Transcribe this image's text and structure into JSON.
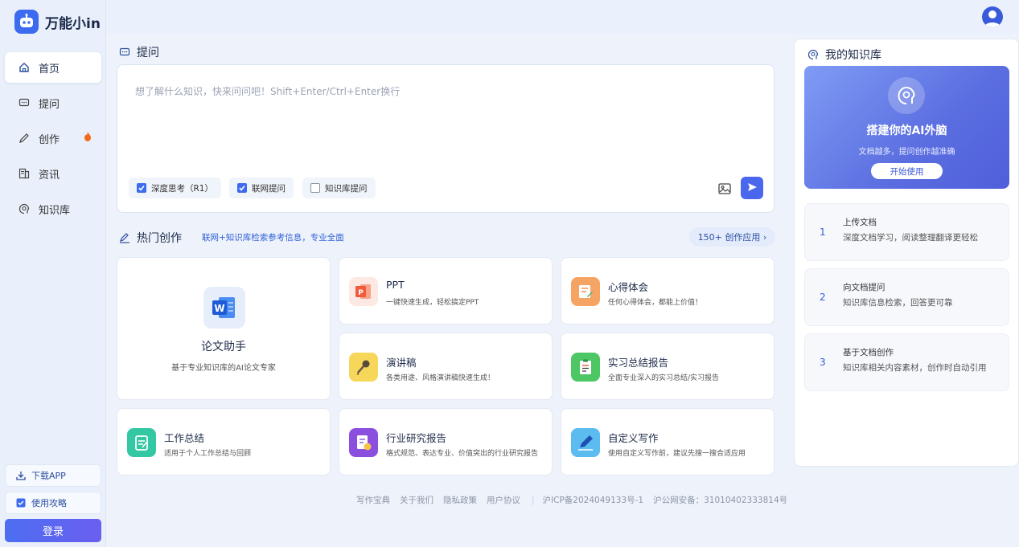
{
  "app": {
    "name": "万能小in"
  },
  "sidebar": {
    "items": [
      {
        "label": "首页",
        "icon": "home-icon",
        "active": true
      },
      {
        "label": "提问",
        "icon": "chat-icon"
      },
      {
        "label": "创作",
        "icon": "pencil-icon",
        "badge": "flame-icon"
      },
      {
        "label": "资讯",
        "icon": "news-icon"
      },
      {
        "label": "知识库",
        "icon": "brain-icon"
      }
    ],
    "download_label": "下载APP",
    "guide_label": "使用攻略",
    "login_label": "登录"
  },
  "ask": {
    "title": "提问",
    "placeholder": "想了解什么知识，快来问问吧！Shift+Enter/Ctrl+Enter换行",
    "options": [
      {
        "label": "深度思考（R1）",
        "checked": true
      },
      {
        "label": "联网提问",
        "checked": true
      },
      {
        "label": "知识库提问",
        "checked": false
      }
    ]
  },
  "hot": {
    "title": "热门创作",
    "subtitle": "联网+知识库检索参考信息，专业全面",
    "more_label": "150+ 创作应用 ›",
    "featured": {
      "title": "论文助手",
      "desc": "基于专业知识库的AI论文专家",
      "icon": "word-icon"
    },
    "cards": [
      {
        "title": "PPT",
        "desc": "一键快速生成，轻松搞定PPT",
        "icon": "ppt-icon",
        "color": "#f15a3a"
      },
      {
        "title": "心得体会",
        "desc": "任何心得体会，都能上价值！",
        "icon": "notes-icon",
        "color": "#f08c4a"
      },
      {
        "title": "演讲稿",
        "desc": "各类用途、风格演讲稿快速生成！",
        "icon": "microphone-icon",
        "color": "#f3c43a"
      },
      {
        "title": "实习总结报告",
        "desc": "全面专业深入的实习总结/实习报告",
        "icon": "clipboard-icon",
        "color": "#3cbf5a"
      },
      {
        "title": "工作总结",
        "desc": "适用于个人工作总结与回顾",
        "icon": "checklist-icon",
        "color": "#2bc6a0"
      },
      {
        "title": "行业研究报告",
        "desc": "格式规范、表达专业、价值突出的行业研究报告",
        "icon": "report-icon",
        "color": "#8b4fe0"
      },
      {
        "title": "自定义写作",
        "desc": "使用自定义写作前，建议先搜一搜合适应用",
        "icon": "pen-icon",
        "color": "#3aa8e8"
      }
    ]
  },
  "footer": {
    "links": [
      "写作宝典",
      "关于我们",
      "隐私政策",
      "用户协议"
    ],
    "icp": "沪ICP备2024049133号-1",
    "police": "沪公网安备：31010402333814号"
  },
  "knowledge": {
    "title": "我的知识库",
    "banner_title": "搭建你的AI外脑",
    "banner_sub": "文档越多，提问创作越准确",
    "banner_button": "开始使用",
    "steps": [
      {
        "num": "1",
        "title": "上传文档",
        "desc": "深度文档学习，阅读整理翻译更轻松"
      },
      {
        "num": "2",
        "title": "向文档提问",
        "desc": "知识库信息检索，回答更可靠"
      },
      {
        "num": "3",
        "title": "基于文档创作",
        "desc": "知识库相关内容素材，创作时自动引用"
      }
    ]
  }
}
